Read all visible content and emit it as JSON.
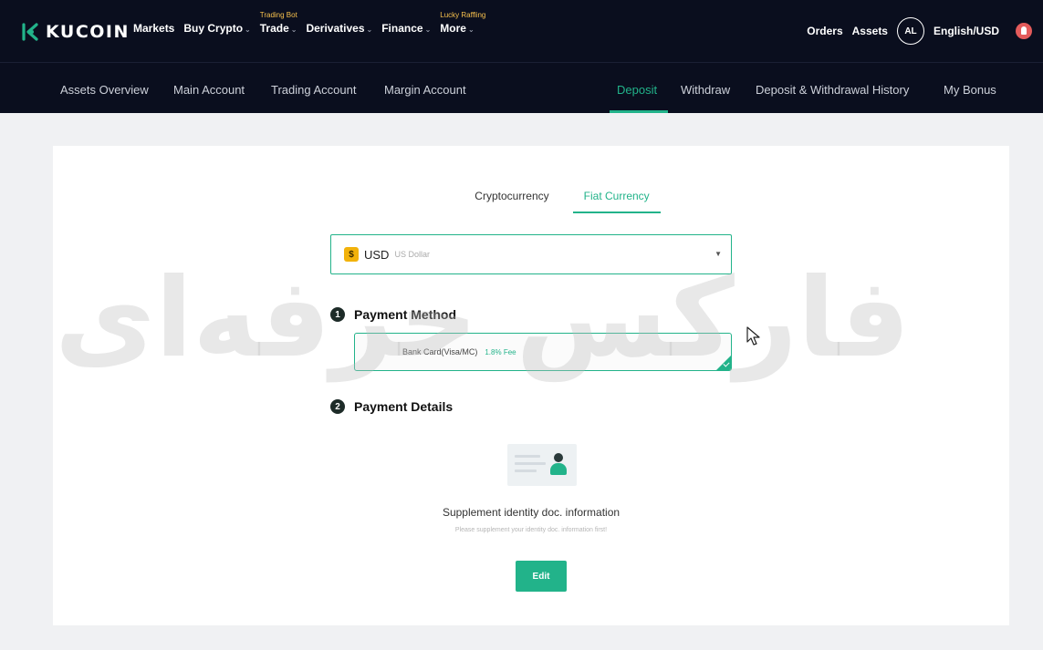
{
  "header": {
    "brand": "KUCOIN",
    "nav": [
      {
        "label": "Markets",
        "caret": false,
        "tag": ""
      },
      {
        "label": "Buy Crypto",
        "caret": true,
        "tag": ""
      },
      {
        "label": "Trade",
        "caret": true,
        "tag": "Trading Bot"
      },
      {
        "label": "Derivatives",
        "caret": true,
        "tag": ""
      },
      {
        "label": "Finance",
        "caret": true,
        "tag": ""
      },
      {
        "label": "More",
        "caret": true,
        "tag": "Lucky Raffling"
      }
    ],
    "orders": "Orders",
    "assets": "Assets",
    "avatar": "AL",
    "language": "English/USD"
  },
  "subnav": {
    "assets_overview": "Assets Overview",
    "main_account": "Main Account",
    "trading_account": "Trading Account",
    "margin_account": "Margin Account",
    "deposit": "Deposit",
    "withdraw": "Withdraw",
    "history": "Deposit & Withdrawal History",
    "bonus": "My Bonus"
  },
  "deposit": {
    "tabs": {
      "crypto": "Cryptocurrency",
      "fiat": "Fiat Currency"
    },
    "currency": {
      "icon": "$",
      "code": "USD",
      "name": "US Dollar"
    },
    "step1": {
      "num": "1",
      "label": "Payment Method"
    },
    "method": {
      "name": "Bank Card(Visa/MC)",
      "fee": "1.8% Fee"
    },
    "step2": {
      "num": "2",
      "label": "Payment Details"
    },
    "supplement": {
      "title": "Supplement identity doc. information",
      "subtitle": "Please supplement your identity doc. information first!"
    },
    "edit": "Edit"
  },
  "watermark": {
    "text": "فارکس حرفه‌ای"
  },
  "colors": {
    "accent": "#22b38a",
    "header": "#0a0e1e",
    "background": "#f0f1f3",
    "watermark": "#e05656"
  }
}
